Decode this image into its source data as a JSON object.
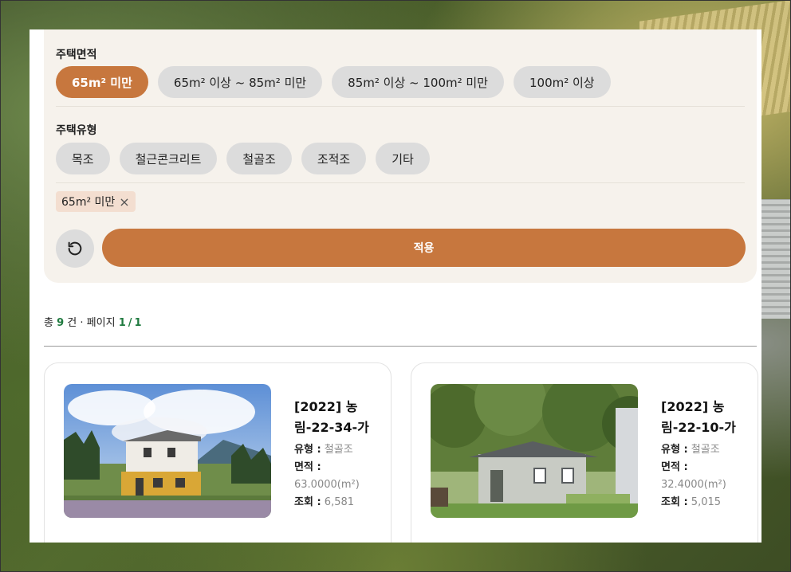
{
  "filters": {
    "area": {
      "title": "주택면적",
      "options": [
        "65m² 미만",
        "65m² 이상 ~ 85m² 미만",
        "85m² 이상 ~ 100m² 미만",
        "100m² 이상"
      ],
      "selected_index": 0
    },
    "type": {
      "title": "주택유형",
      "options": [
        "목조",
        "철근콘크리트",
        "철골조",
        "조적조",
        "기타"
      ]
    },
    "active_tag": "65m² 미만",
    "tag_remove_symbol": "×",
    "apply_label": "적용"
  },
  "results": {
    "prefix": "총",
    "total": "9",
    "unit": "건 · 페이지",
    "page_current": "1",
    "page_sep": "/",
    "page_total": "1"
  },
  "cards": [
    {
      "title": "[2022] 농림-22-34-가",
      "type_label": "유형 :",
      "type_value": "철골조",
      "area_label": "면적 :",
      "area_value": "63.0000(m²)",
      "views_label": "조회 :",
      "views_value": "6,581"
    },
    {
      "title": "[2022] 농림-22-10-가",
      "type_label": "유형 :",
      "type_value": "철골조",
      "area_label": "면적 :",
      "area_value": "32.4000(m²)",
      "views_label": "조회 :",
      "views_value": "5,015"
    }
  ],
  "colors": {
    "accent": "#c7773e",
    "chip_bg": "#dcdcdc",
    "count_highlight": "#1f7a3f",
    "filter_bg": "#f6f2ec",
    "tag_bg": "#f3ded0"
  },
  "icons": {
    "reset": "rotate-ccw-icon",
    "remove": "close-icon"
  }
}
